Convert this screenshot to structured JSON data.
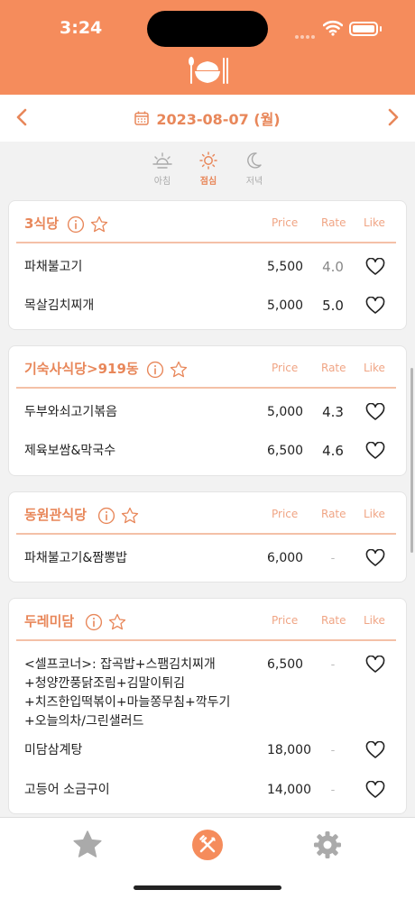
{
  "status": {
    "time": "3:24"
  },
  "header": {
    "logo_icon": "rice-bowl-with-spoon-and-chopsticks-icon"
  },
  "date_bar": {
    "date": "2023-08-07 (월)",
    "prev_icon": "chevron-left-icon",
    "next_icon": "chevron-right-icon"
  },
  "meals": [
    {
      "label": "아침",
      "icon": "sunrise-icon",
      "active": false
    },
    {
      "label": "점심",
      "icon": "sun-icon",
      "active": true
    },
    {
      "label": "저녁",
      "icon": "moon-icon",
      "active": false
    }
  ],
  "columns": {
    "price": "Price",
    "rate": "Rate",
    "like": "Like"
  },
  "restaurants": [
    {
      "name": "3식당",
      "menus": [
        {
          "item": "파채불고기",
          "price": "5,500",
          "rate": "4.0"
        },
        {
          "item": "목살김치찌개",
          "price": "5,000",
          "rate": "5.0"
        }
      ]
    },
    {
      "name": "기숙사식당>919동",
      "menus": [
        {
          "item": "두부와쇠고기볶음",
          "price": "5,000",
          "rate": "4.3"
        },
        {
          "item": "제육보쌈&막국수",
          "price": "6,500",
          "rate": "4.6"
        }
      ]
    },
    {
      "name": "동원관식당",
      "menus": [
        {
          "item": "파채불고기&짬뽕밥",
          "price": "6,000",
          "rate": "-"
        }
      ]
    },
    {
      "name": "두레미담",
      "menus": [
        {
          "item_lines": [
            "<셀프코너>: 잡곡밥+스팸김치찌개",
            "+청양깐풍닭조림+김말이튀김",
            "+치즈한입떡볶이+마늘쫑무침+깍두기",
            "+오늘의차/그린샐러드"
          ],
          "price": "6,500",
          "rate": "-"
        },
        {
          "item": "미담삼계탕",
          "price": "18,000",
          "rate": "-"
        },
        {
          "item": "고등어 소금구이",
          "price": "14,000",
          "rate": "-"
        }
      ]
    }
  ],
  "tabs": [
    {
      "icon": "star-icon",
      "active": false
    },
    {
      "icon": "fork-knife-icon",
      "active": true
    },
    {
      "icon": "gear-icon",
      "active": false
    }
  ],
  "colors": {
    "accent": "#f58c5c",
    "accent_text": "#e8875a",
    "divider": "#f4c0a7",
    "inactive_icon": "#aaaaaa"
  }
}
